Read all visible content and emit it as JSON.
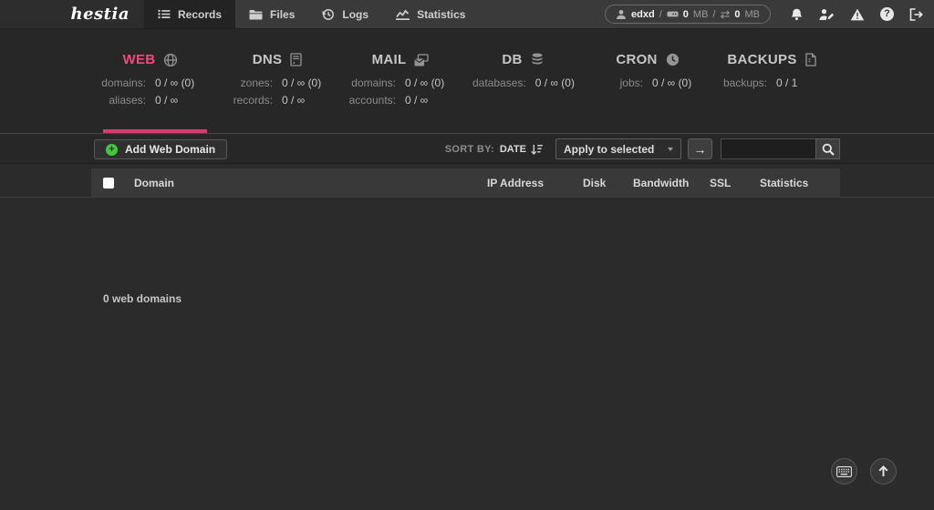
{
  "topbar": {
    "logo": "hestia",
    "nav": [
      {
        "label": "Records",
        "active": true
      },
      {
        "label": "Files",
        "active": false
      },
      {
        "label": "Logs",
        "active": false
      },
      {
        "label": "Statistics",
        "active": false
      }
    ],
    "usage": {
      "user": "edxd",
      "sep": "/",
      "disk_value": "0",
      "disk_unit": "MB",
      "net_value": "0",
      "net_unit": "MB",
      "exchange_glyph": "⇄"
    },
    "question_glyph": "?"
  },
  "stats": {
    "columns": [
      {
        "title": "WEB",
        "icon": "globe-icon",
        "active": true,
        "rows": [
          {
            "key": "domains:",
            "value": "0 / ∞ (0)"
          },
          {
            "key": "aliases:",
            "value": "0 / ∞"
          }
        ]
      },
      {
        "title": "DNS",
        "icon": "server-icon",
        "active": false,
        "rows": [
          {
            "key": "zones:",
            "value": "0 / ∞ (0)"
          },
          {
            "key": "records:",
            "value": "0 / ∞"
          }
        ]
      },
      {
        "title": "MAIL",
        "icon": "mail-icon",
        "active": false,
        "rows": [
          {
            "key": "domains:",
            "value": "0 / ∞ (0)"
          },
          {
            "key": "accounts:",
            "value": "0 / ∞"
          }
        ]
      },
      {
        "title": "DB",
        "icon": "database-icon",
        "active": false,
        "rows": [
          {
            "key": "databases:",
            "value": "0 / ∞ (0)"
          }
        ]
      },
      {
        "title": "CRON",
        "icon": "clock-icon",
        "active": false,
        "rows": [
          {
            "key": "jobs:",
            "value": "0 / ∞ (0)"
          }
        ]
      },
      {
        "title": "BACKUPS",
        "icon": "archive-file-icon",
        "active": false,
        "rows": [
          {
            "key": "backups:",
            "value": "0 / 1"
          }
        ]
      }
    ]
  },
  "toolbar": {
    "add_button_label": "Add Web Domain",
    "plus_glyph": "+",
    "sort_label": "SORT BY:",
    "sort_value": "DATE",
    "apply_select_value": "Apply to selected",
    "apply_go_glyph": "→",
    "search_value": ""
  },
  "table": {
    "headers": [
      "Domain",
      "IP Address",
      "Disk",
      "Bandwidth",
      "SSL",
      "Statistics"
    ],
    "empty_message": "0 web domains"
  },
  "colors": {
    "accent_pink": "#d83b6d",
    "web_title_pink": "#ef4a7b",
    "add_green": "#3ecc3e",
    "topbar_bg": "#3a3a3a",
    "panel_bg": "#272727",
    "header_row_bg": "#393939"
  }
}
